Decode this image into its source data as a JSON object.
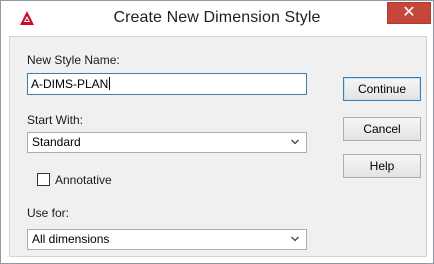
{
  "window": {
    "title": "Create New Dimension Style",
    "close_glyph": "✕",
    "app_icon": "autocad-a-icon",
    "accent": "#c7463b"
  },
  "form": {
    "new_style_label": "New Style Name:",
    "new_style_value": "A-DIMS-PLAN",
    "start_with_label": "Start With:",
    "start_with_value": "Standard",
    "annotative_label": "Annotative",
    "annotative_checked": false,
    "use_for_label": "Use for:",
    "use_for_value": "All dimensions"
  },
  "buttons": {
    "continue": "Continue",
    "cancel": "Cancel",
    "help": "Help"
  }
}
